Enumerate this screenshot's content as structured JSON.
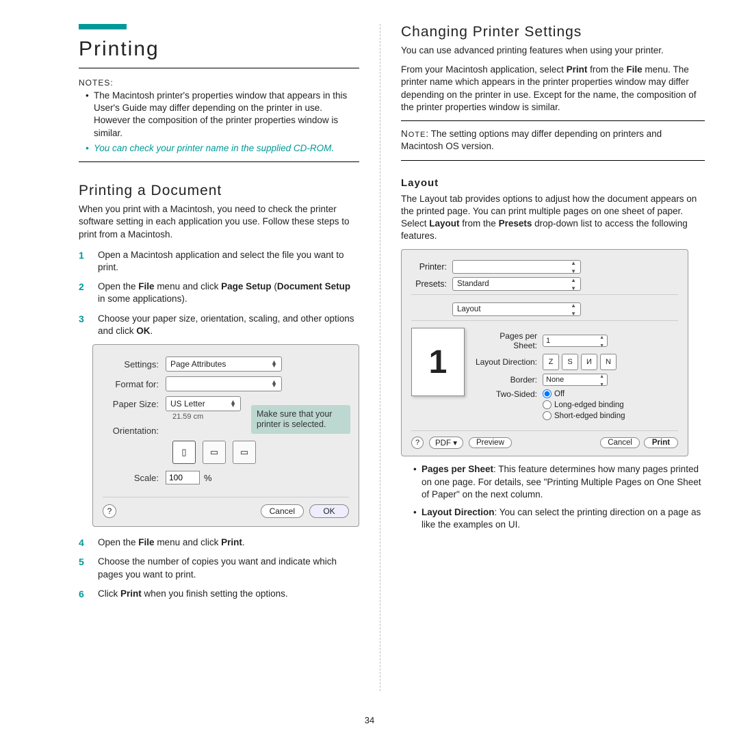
{
  "pageNumber": "34",
  "left": {
    "accentPresent": true,
    "title": "Printing",
    "notesLabel": "NOTES:",
    "notes": [
      "The Macintosh printer's properties window that appears in this User's Guide may differ depending on the printer in use. However the composition of the printer properties window is similar.",
      "You can check your printer name in the supplied CD-ROM."
    ],
    "subTitle": "Printing a Document",
    "intro": "When you print with a Macintosh, you need to check the printer software setting in each application you use. Follow these steps to print from a Macintosh.",
    "steps1": [
      {
        "n": "1",
        "t": "Open a Macintosh application and select the file you want to print."
      },
      {
        "n": "2",
        "t": "Open the File menu and click Page Setup (Document Setup in some applications).",
        "bold": [
          "File",
          "Page Setup",
          "Document Setup"
        ]
      },
      {
        "n": "3",
        "t": "Choose your paper size, orientation, scaling, and other options and click OK.",
        "bold": [
          "OK"
        ]
      }
    ],
    "dialog1": {
      "settingsLabel": "Settings:",
      "settingsValue": "Page Attributes",
      "formatForLabel": "Format for:",
      "formatForValue": "",
      "paperSizeLabel": "Paper Size:",
      "paperSizeValue": "US Letter",
      "paperSizeSub": "21.59 cm",
      "callout": "Make sure that your printer is selected.",
      "orientationLabel": "Orientation:",
      "scaleLabel": "Scale:",
      "scaleValue": "100",
      "scalePct": "%",
      "cancel": "Cancel",
      "ok": "OK",
      "help": "?"
    },
    "steps2": [
      {
        "n": "4",
        "t": "Open the File menu and click Print.",
        "bold": [
          "File",
          "Print"
        ]
      },
      {
        "n": "5",
        "t": "Choose the number of copies you want and indicate which pages you want to print."
      },
      {
        "n": "6",
        "t": "Click Print when you finish setting the options.",
        "bold": [
          "Print"
        ]
      }
    ]
  },
  "right": {
    "title": "Changing Printer Settings",
    "para1": "You can use advanced printing features when using your printer.",
    "para2": "From your Macintosh application, select Print from the File menu. The printer name which appears in the printer properties window may differ depending on the printer in use. Except for the name, the composition of the printer properties window is similar.",
    "noteBox": "NOTE: The setting options may differ depending on printers and Macintosh OS version.",
    "h3": "Layout",
    "layoutPara": "The Layout tab provides options to adjust how the document appears on the printed page. You can print multiple pages on one sheet of paper. Select Layout from the Presets drop-down list to access the following features.",
    "dialog2": {
      "printerLabel": "Printer:",
      "presetsLabel": "Presets:",
      "presetsValue": "Standard",
      "panelValue": "Layout",
      "previewNum": "1",
      "ppsLabel": "Pages per Sheet:",
      "ppsValue": "1",
      "dirLabel": "Layout Direction:",
      "borderLabel": "Border:",
      "borderValue": "None",
      "twoSidedLabel": "Two-Sided:",
      "twoSided": {
        "off": "Off",
        "long": "Long-edged binding",
        "short": "Short-edged binding"
      },
      "help": "?",
      "pdf": "PDF ▾",
      "preview": "Preview",
      "cancel": "Cancel",
      "print": "Print"
    },
    "features": [
      {
        "lead": "Pages per Sheet",
        "rest": ": This feature determines how many pages printed on one page. For details, see \"Printing Multiple Pages on One Sheet of Paper\" on the next column."
      },
      {
        "lead": "Layout Direction",
        "rest": ": You can select the printing direction on a page as like the examples on UI."
      }
    ]
  }
}
